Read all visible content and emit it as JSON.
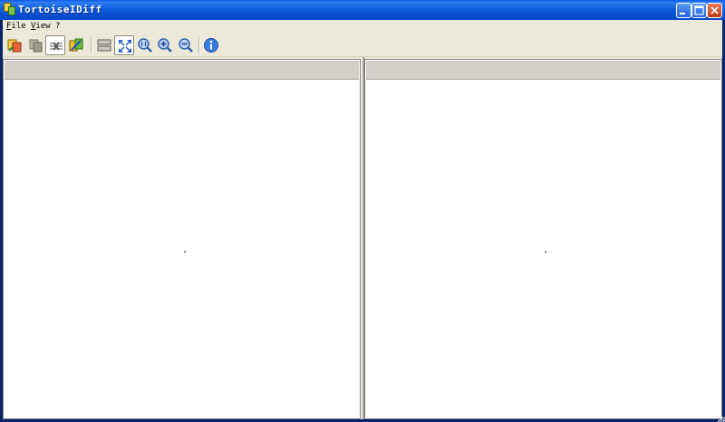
{
  "window": {
    "title": "TortoiseIDiff"
  },
  "menu": {
    "file": {
      "underline": "F",
      "rest": "ile"
    },
    "view": {
      "underline": "V",
      "rest": "iew"
    },
    "help": {
      "label": "?"
    }
  },
  "toolbar": {
    "tools": [
      "overlay-icon",
      "blend-icon",
      "link-images-icon",
      "fit-together-icon",
      "vertical-layout-icon",
      "fit-image-icon",
      "original-size-icon",
      "zoom-in-icon",
      "zoom-out-icon",
      "info-icon"
    ],
    "pressed": [
      "link-images-icon",
      "fit-image-icon"
    ]
  },
  "colors": {
    "titlebar": "#0a58da",
    "chrome": "#ece9d8",
    "pane_header": "#d4d0c8",
    "close_button": "#c13a12"
  }
}
